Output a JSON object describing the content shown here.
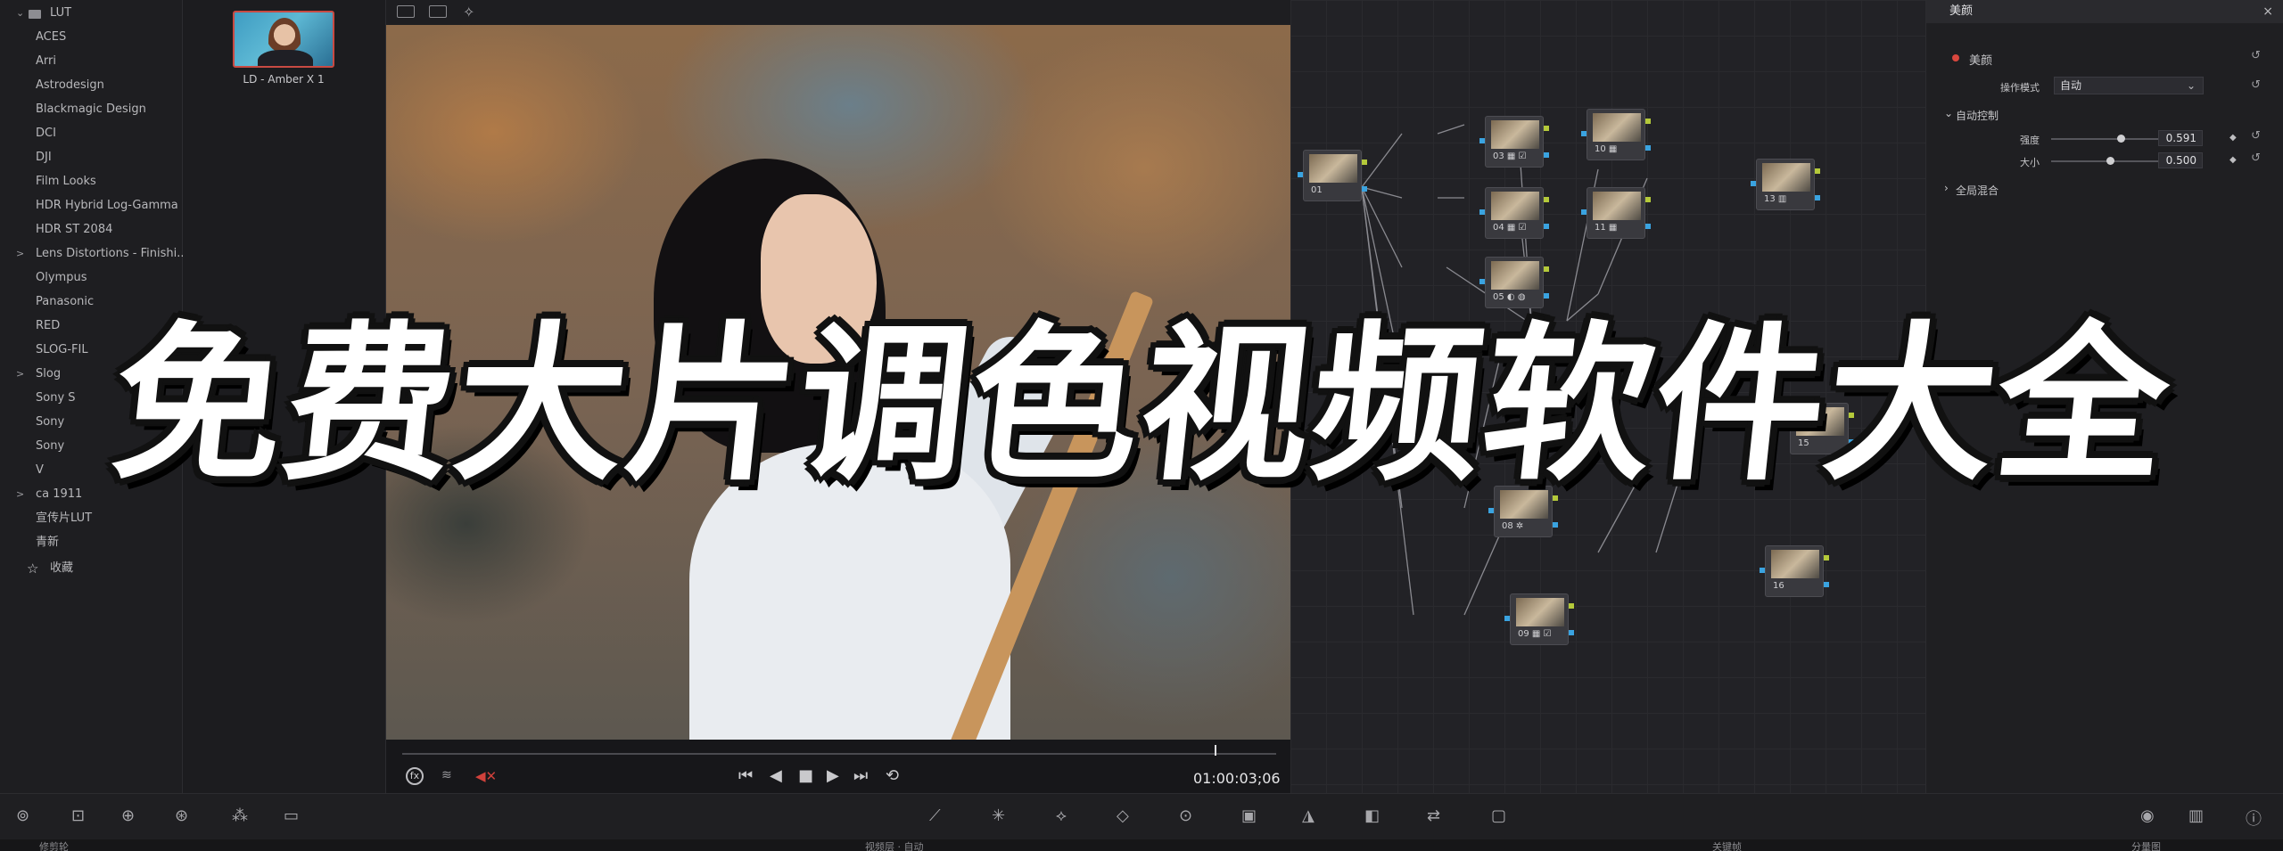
{
  "lut_panel": {
    "root": "LUT",
    "items": [
      {
        "label": "ACES",
        "caret": ""
      },
      {
        "label": "Arri",
        "caret": ""
      },
      {
        "label": "Astrodesign",
        "caret": ""
      },
      {
        "label": "Blackmagic Design",
        "caret": ""
      },
      {
        "label": "DCI",
        "caret": ""
      },
      {
        "label": "DJI",
        "caret": ""
      },
      {
        "label": "Film Looks",
        "caret": ""
      },
      {
        "label": "HDR Hybrid Log-Gamma",
        "caret": ""
      },
      {
        "label": "HDR ST 2084",
        "caret": ""
      },
      {
        "label": "Lens Distortions - Finishi...",
        "caret": ">"
      },
      {
        "label": "Olympus",
        "caret": ""
      },
      {
        "label": "Panasonic",
        "caret": ""
      },
      {
        "label": "RED",
        "caret": ""
      },
      {
        "label": "SLOG-FIL",
        "caret": ""
      },
      {
        "label": "Slog",
        "caret": ">"
      },
      {
        "label": "Sony S",
        "caret": ""
      },
      {
        "label": "Sony",
        "caret": ""
      },
      {
        "label": "Sony",
        "caret": ""
      },
      {
        "label": "V",
        "caret": ""
      },
      {
        "label": "ca          1911",
        "caret": ">"
      },
      {
        "label": "宣传片LUT",
        "caret": ""
      },
      {
        "label": "青新",
        "caret": ""
      }
    ],
    "favorites": "收藏"
  },
  "thumbnail": {
    "label": "LD - Amber X 1"
  },
  "viewer": {
    "timecode": "01:00:03;06",
    "fx_label": "fx",
    "playhead_fraction": 0.93
  },
  "nodes": [
    {
      "id": "01",
      "icons": ""
    },
    {
      "id": "03",
      "icons": "▦ ☑"
    },
    {
      "id": "10",
      "icons": "▦"
    },
    {
      "id": "04",
      "icons": "▦ ☑"
    },
    {
      "id": "11",
      "icons": "▦"
    },
    {
      "id": "05",
      "icons": "◐ ◍"
    },
    {
      "id": "13",
      "icons": "▥"
    },
    {
      "id": "08",
      "icons": "✲"
    },
    {
      "id": "09",
      "icons": "▦ ☑"
    },
    {
      "id": "15",
      "icons": ""
    },
    {
      "id": "16",
      "icons": ""
    }
  ],
  "inspector": {
    "title": "美颜",
    "close": "×",
    "effect_name": "美颜",
    "mode_label": "操作模式",
    "mode_value": "自动",
    "auto_section": "自动控制",
    "params": [
      {
        "label": "强度",
        "value": "0.591",
        "fraction": 0.591
      },
      {
        "label": "大小",
        "value": "0.500",
        "fraction": 0.5
      }
    ],
    "global_section": "全局混合"
  },
  "bottom_bar": {
    "sub_left": "修剪轮",
    "sub_mid": "视频层 · 自动",
    "sub_mid2": "关键帧",
    "sub_right": "分量图"
  },
  "overlay_title": "免费大片调色视频软件大全"
}
